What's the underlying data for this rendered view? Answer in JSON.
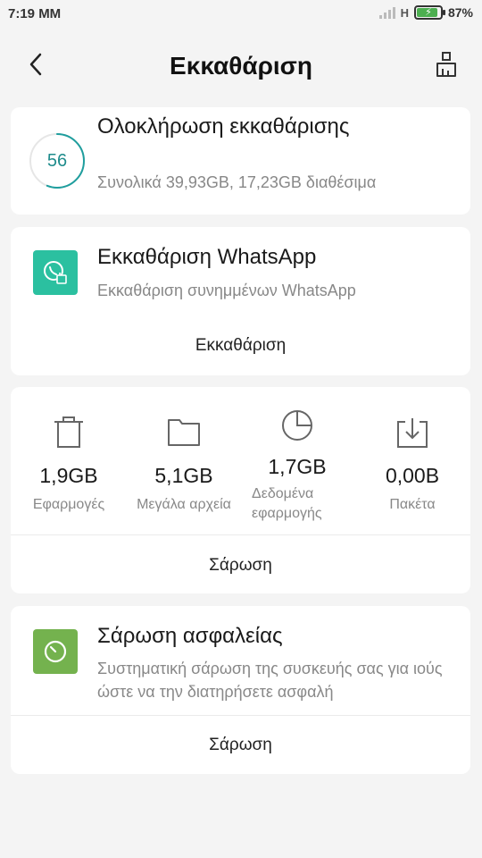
{
  "status": {
    "time": "7:19 MM",
    "network": "H",
    "battery": "87%",
    "battery_level": 0.87
  },
  "header": {
    "title": "Εκκαθάριση",
    "back_icon": "back-arrow-icon",
    "action_icon": "broom-icon"
  },
  "completion": {
    "score": "56",
    "title": "Ολοκλήρωση εκκαθάρισης",
    "subtitle": "Συνολικά 39,93GB, 17,23GB διαθέσιμα",
    "ring_progress": 0.56,
    "ring_color": "#1f9e9e"
  },
  "whatsapp": {
    "title": "Εκκαθάριση WhatsApp",
    "subtitle": "Εκκαθάριση συνημμένων WhatsApp",
    "button": "Εκκαθάριση",
    "icon": "whatsapp-clean-icon",
    "icon_color": "#2bc0a0"
  },
  "storage": {
    "items": [
      {
        "value": "1,9GB",
        "label": "Εφαρμογές",
        "icon": "trash-icon"
      },
      {
        "value": "5,1GB",
        "label": "Μεγάλα αρχεία",
        "icon": "folder-icon"
      },
      {
        "value": "1,7GB",
        "label": "Δεδομένα εφαρμογής",
        "icon": "pie-chart-icon"
      },
      {
        "value": "0,00B",
        "label": "Πακέτα",
        "icon": "download-box-icon"
      }
    ],
    "button": "Σάρωση"
  },
  "security": {
    "title": "Σάρωση ασφαλείας",
    "subtitle": "Συστηματική σάρωση της συσκευής σας για ιούς ώστε να την διατηρήσετε ασφαλή",
    "button": "Σάρωση",
    "icon": "security-timer-icon",
    "icon_color": "#74b24e"
  }
}
